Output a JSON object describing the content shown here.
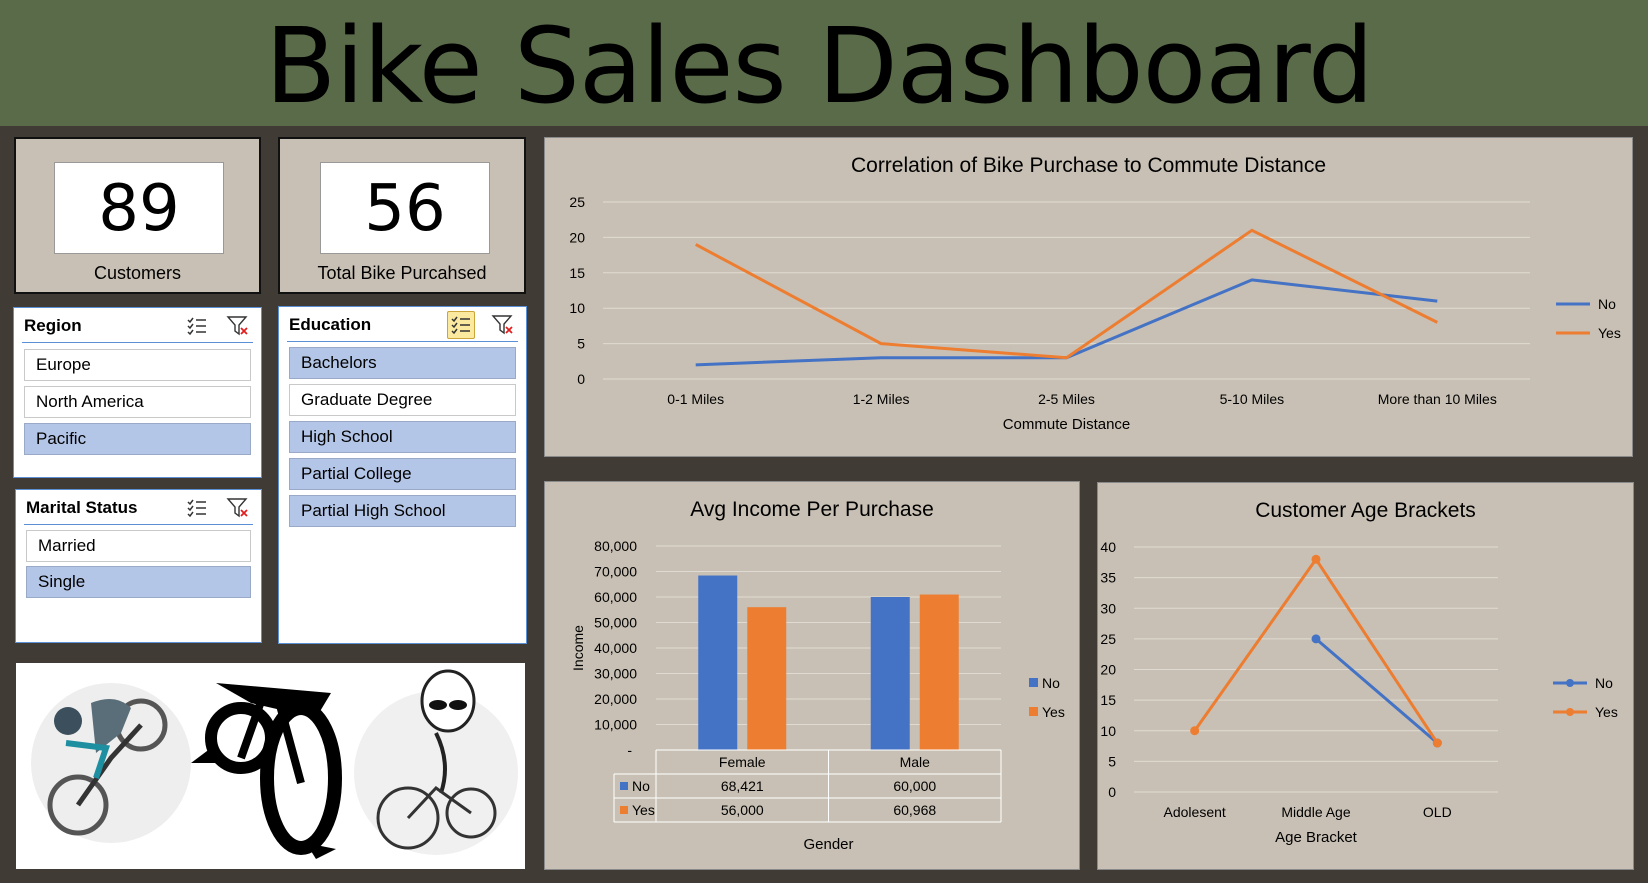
{
  "header": {
    "title": "Bike Sales Dashboard"
  },
  "kpis": {
    "customers": {
      "value": "89",
      "label": "Customers"
    },
    "bikes": {
      "value": "56",
      "label": "Total Bike Purcahsed"
    }
  },
  "slicers": {
    "region": {
      "title": "Region",
      "items": [
        {
          "label": "Europe",
          "selected": false
        },
        {
          "label": "North America",
          "selected": false
        },
        {
          "label": "Pacific",
          "selected": true
        }
      ]
    },
    "education": {
      "title": "Education",
      "items": [
        {
          "label": "Bachelors",
          "selected": true
        },
        {
          "label": "Graduate Degree",
          "selected": false
        },
        {
          "label": "High School",
          "selected": true
        },
        {
          "label": "Partial College",
          "selected": true
        },
        {
          "label": "Partial High School",
          "selected": true
        }
      ]
    },
    "marital": {
      "title": "Marital Status",
      "items": [
        {
          "label": "Married",
          "selected": false
        },
        {
          "label": "Single",
          "selected": true
        }
      ]
    }
  },
  "icons": {
    "multiselect": "multi-select-icon",
    "clearfilter": "clear-filter-icon",
    "images": [
      "mountain-biker-illustration",
      "bicycle-logo",
      "alien-on-bicycle-illustration"
    ]
  },
  "colors": {
    "no": "#4472c4",
    "yes": "#ed7d31",
    "panel": "#c8c0b4",
    "header": "#5a6b4a",
    "selected": "#b4c6e7"
  },
  "chart_data": [
    {
      "id": "commute",
      "type": "line",
      "title": "Correlation of Bike Purchase to Commute Distance",
      "xlabel": "Commute Distance",
      "ylabel": "",
      "categories": [
        "0-1 Miles",
        "1-2 Miles",
        "2-5 Miles",
        "5-10 Miles",
        "More than 10 Miles"
      ],
      "series": [
        {
          "name": "No",
          "values": [
            2,
            3,
            3,
            14,
            11
          ]
        },
        {
          "name": "Yes",
          "values": [
            19,
            5,
            3,
            21,
            8
          ]
        }
      ],
      "ylim": [
        0,
        25
      ],
      "yticks": [
        "0",
        "5",
        "10",
        "15",
        "20",
        "25"
      ],
      "grid": true,
      "legend": "right"
    },
    {
      "id": "income",
      "type": "bar",
      "title": "Avg Income Per Purchase",
      "xlabel": "Gender",
      "ylabel": "Income",
      "categories": [
        "Female",
        "Male"
      ],
      "series": [
        {
          "name": "No",
          "values": [
            68421,
            60000
          ],
          "labels": [
            "68,421",
            "60,000"
          ]
        },
        {
          "name": "Yes",
          "values": [
            56000,
            60968
          ],
          "labels": [
            "56,000",
            "60,968"
          ]
        }
      ],
      "ylim": [
        0,
        80000
      ],
      "yticks": [
        "-",
        "10,000",
        "20,000",
        "30,000",
        "40,000",
        "50,000",
        "60,000",
        "70,000",
        "80,000"
      ],
      "grid": true,
      "legend": "right",
      "data_table": true
    },
    {
      "id": "age",
      "type": "line",
      "title": "Customer Age Brackets",
      "xlabel": "Age Bracket",
      "ylabel": "",
      "categories": [
        "Adolesent",
        "Middle Age",
        "OLD"
      ],
      "series": [
        {
          "name": "No",
          "values": [
            null,
            25,
            8
          ]
        },
        {
          "name": "Yes",
          "values": [
            10,
            38,
            8
          ]
        }
      ],
      "ylim": [
        0,
        40
      ],
      "yticks": [
        "0",
        "5",
        "10",
        "15",
        "20",
        "25",
        "30",
        "35",
        "40"
      ],
      "grid": true,
      "markers": true,
      "legend": "right"
    }
  ]
}
